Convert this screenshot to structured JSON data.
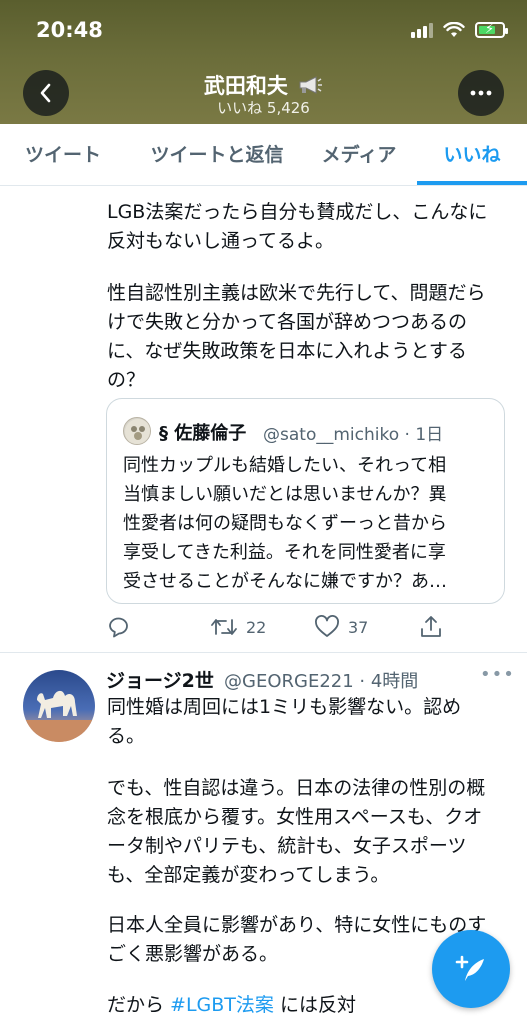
{
  "status_bar": {
    "time": "20:48"
  },
  "header": {
    "name": "武田和夫",
    "name_icon": "megaphone-icon",
    "subtitle": "いいね 5,426",
    "back_icon": "chevron-left-icon",
    "more_icon": "more-horizontal-icon"
  },
  "tabs": [
    {
      "label": "ツイート",
      "active": false
    },
    {
      "label": "ツイートと返信",
      "active": false
    },
    {
      "label": "メディア",
      "active": false
    },
    {
      "label": "いいね",
      "active": true
    }
  ],
  "tweet1": {
    "text": [
      "LGB法案だったら自分も賛成だし、こんなに",
      "反対もないし通ってるよ。",
      "性自認性別主義は欧米で先行して、問題だら",
      "けで失敗と分かって各国が辞めつつあるの",
      "に、なぜ失敗政策を日本に入れようとする",
      "の？"
    ],
    "quote": {
      "name": "§ 佐藤倫子",
      "handle": "@sato__michiko · 1日",
      "text": [
        "同性カップルも結婚したい、それって相",
        "当慎ましい願いだとは思いませんか？異",
        "性愛者は何の疑問もなくずーっと昔から",
        "享受してきた利益。それを同性愛者に享",
        "受させることがそんなに嫌ですか？あ…"
      ]
    },
    "actions": {
      "reply": "",
      "retweet": "22",
      "like": "37"
    }
  },
  "tweet2": {
    "name": "ジョージ2世",
    "handle": "@GEORGE221 · 4時間",
    "more": "•••",
    "text": [
      "同性婚は周回には1ミリも影響ない。認め",
      "る。",
      "でも、性自認は違う。日本の法律の性別の概",
      "念を根底から覆す。女性用スペースも、クオ",
      "ータ制やパリテも、統計も、女子スポーツ",
      "も、全部定義が変わってしまう。",
      "日本人全員に影響があり、特に女性にものす",
      "ごく悪影響がある。"
    ],
    "last_line_prefix": "だから ",
    "hashtag": "#LGBT法案",
    "last_line_suffix": " には反対"
  },
  "fab": {
    "icon": "compose-tweet-icon"
  },
  "colors": {
    "accent": "#1d9bf0",
    "secondary_text": "#536471"
  }
}
